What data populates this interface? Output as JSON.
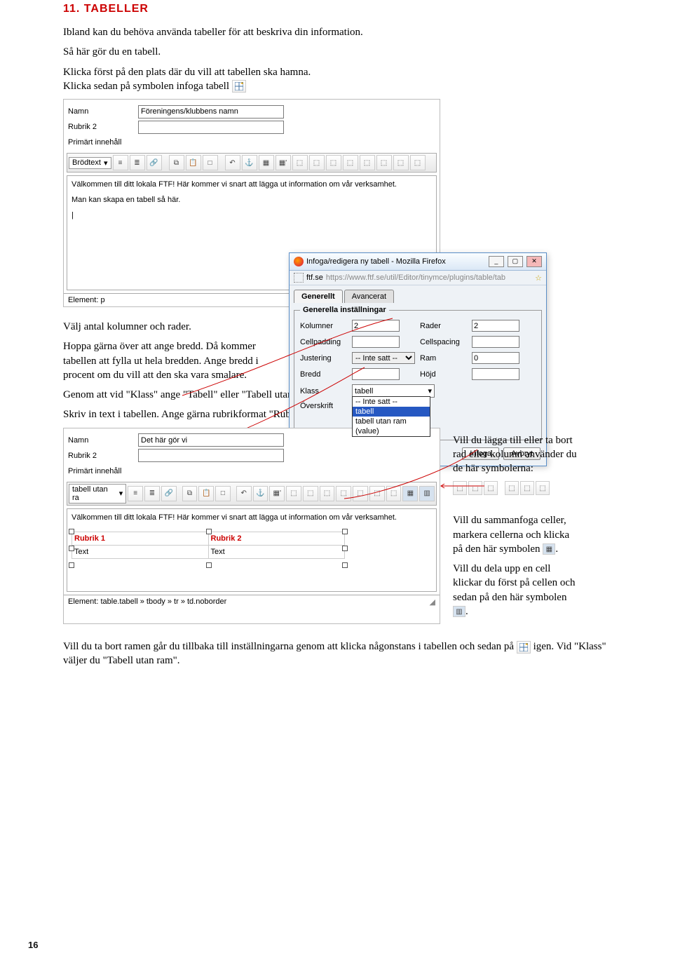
{
  "heading": "11. TABELLER",
  "intro": "Ibland kan du behöva använda tabeller för att beskriva din information.",
  "intro2": "Så här gör du en tabell.",
  "intro3a": "Klicka först på den plats där du vill att tabellen ska hamna.",
  "intro3b": "Klicka sedan på symbolen infoga tabell",
  "editor1": {
    "labels": {
      "namn": "Namn",
      "rubrik2": "Rubrik 2",
      "primart": "Primärt innehåll"
    },
    "namn_value": "Föreningens/klubbens namn",
    "style_select": "Brödtext",
    "body_line1": "Välkommen till ditt lokala FTF! Här kommer vi snart att lägga ut information om vår verksamhet.",
    "body_line2": "Man kan skapa en tabell så här.",
    "cursor": "|",
    "element_path": "Element: p"
  },
  "mid_p1": "Välj antal kolumner och rader.",
  "mid_p2": "Hoppa gärna över att ange bredd. Då kommer tabellen att fylla ut hela bredden. Ange bredd i procent om du vill att den ska vara smalare.",
  "mid_p3": "Genom att vid \"Klass\" ange \"Tabell\" eller \"Tabell utan ram\" får du ett snygg fördefinierat utseende på tabellen.",
  "mid_p4": "Skriv in text i tabellen. Ange gärna rubrikformat \"Rubrik 3 (grön)\" till tabellens rubrikrad.",
  "dialog": {
    "title": "Infoga/redigera ny tabell - Mozilla Firefox",
    "url_host": "ftf.se",
    "url": "https://www.ftf.se/util/Editor/tinymce/plugins/table/tab",
    "tabs": {
      "gen": "Generellt",
      "adv": "Avancerat"
    },
    "legend": "Generella inställningar",
    "labels": {
      "kolumner": "Kolumner",
      "rader": "Rader",
      "cellpadding": "Cellpadding",
      "cellspacing": "Cellspacing",
      "justering": "Justering",
      "ram": "Ram",
      "bredd": "Bredd",
      "hojd": "Höjd",
      "klass": "Klass",
      "overskrift": "Överskrift"
    },
    "values": {
      "kolumner": "2",
      "rader": "2",
      "justering": "-- Inte satt --",
      "ram": "0",
      "klass": "tabell",
      "dd_opt1": "-- Inte satt --",
      "dd_opt2": "tabell",
      "dd_opt3": "tabell utan ram",
      "dd_opt4": "(value)"
    },
    "buttons": {
      "infoga": "Infoga",
      "avbryt": "Avbryt"
    }
  },
  "editor2": {
    "labels": {
      "namn": "Namn",
      "rubrik2": "Rubrik 2",
      "primart": "Primärt innehåll"
    },
    "namn_value": "Det här gör vi",
    "style_select": "tabell utan ra",
    "body_line1": "Välkommen till ditt lokala FTF! Här kommer vi snart att lägga ut information om vår verksamhet.",
    "table": {
      "r1c1": "Rubrik 1",
      "r1c2": "Rubrik 2",
      "r2c1": "Text",
      "r2c2": "Text"
    },
    "element_path": "Element: table.tabell » tbody » tr » td.noborder"
  },
  "side": {
    "p1": "Vill du lägga till eller ta bort rad eller kolumn använder du de här symbolerna:",
    "p2a": "Vill du sammanfoga celler, markera cellerna och klicka på den här symbolen ",
    "p2b": ".",
    "p3a": "Vill du dela upp en cell klickar du först på cellen och sedan på den här symbolen ",
    "p3b": "."
  },
  "tail_a": "Vill du ta bort ramen går du tillbaka till inställningarna genom att klicka någonstans i tabellen och sedan på ",
  "tail_b": " igen. Vid \"Klass\" väljer du \"Tabell utan ram\".",
  "page_number": "16"
}
